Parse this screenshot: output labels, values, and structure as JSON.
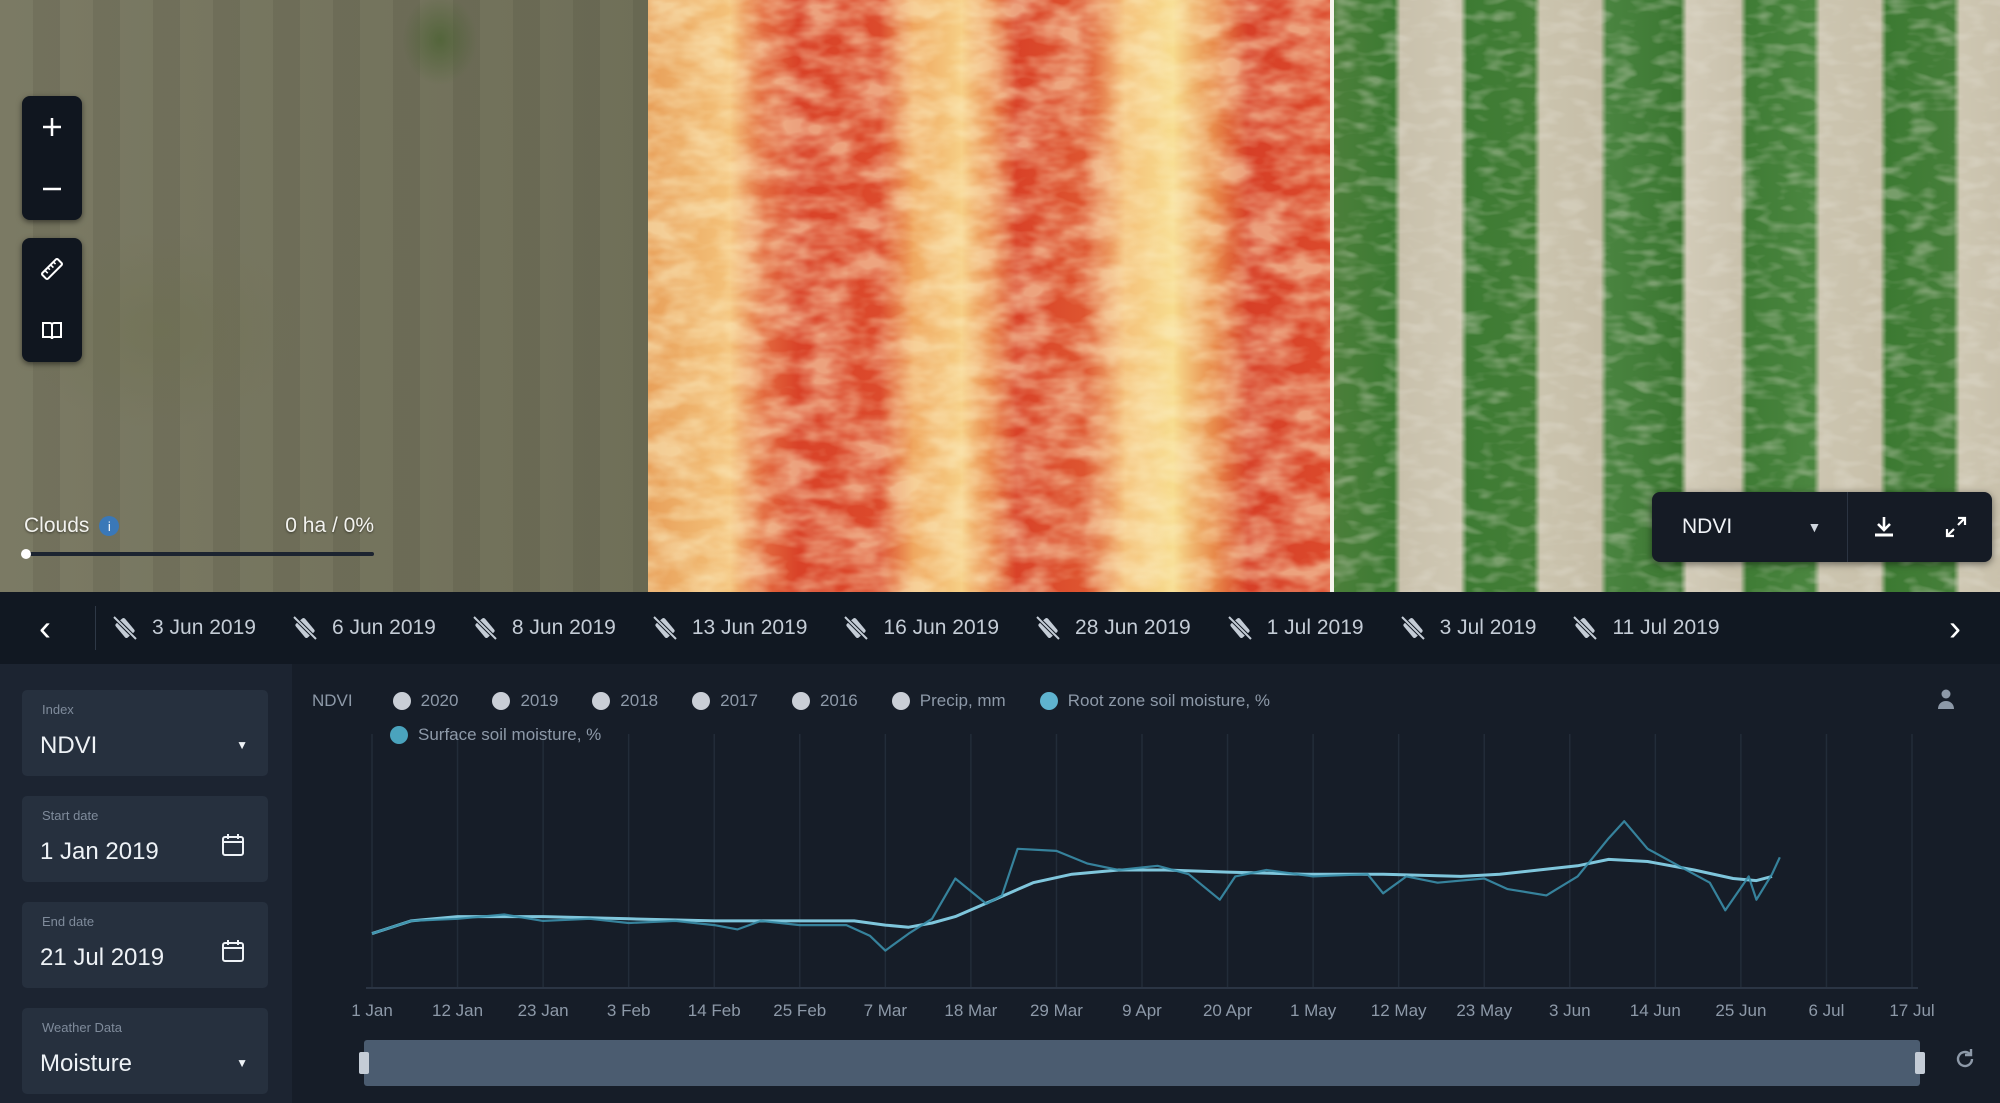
{
  "map": {
    "zoom_in_icon": "plus-icon",
    "zoom_out_icon": "minus-icon",
    "ruler_icon": "ruler-icon",
    "book_icon": "book-icon",
    "clouds": {
      "label": "Clouds",
      "value": "0 ha / 0%",
      "level": 0
    },
    "layer": {
      "name": "NDVI",
      "caret": "▼"
    },
    "colors": {
      "ndvi_red": "#dc4a2c",
      "ndvi_yellow": "#f7dc8e",
      "crop_green": "#3c7a32",
      "soil_beige": "#c9c1ac"
    }
  },
  "date_strip": {
    "prev": "‹",
    "next": "›",
    "dates": [
      "3 Jun 2019",
      "6 Jun 2019",
      "8 Jun 2019",
      "13 Jun 2019",
      "16 Jun 2019",
      "28 Jun 2019",
      "1 Jul 2019",
      "3 Jul 2019",
      "11 Jul 2019"
    ]
  },
  "sidebar": {
    "index": {
      "label": "Index",
      "value": "NDVI",
      "caret": "▼"
    },
    "start_date": {
      "label": "Start date",
      "value": "1 Jan 2019"
    },
    "end_date": {
      "label": "End date",
      "value": "21 Jul 2019"
    },
    "weather": {
      "label": "Weather Data",
      "value": "Moisture",
      "caret": "▼"
    }
  },
  "legend": {
    "index_tag": "NDVI",
    "items": [
      {
        "label": "2020",
        "color": "#c9ced6"
      },
      {
        "label": "2019",
        "color": "#c9ced6"
      },
      {
        "label": "2018",
        "color": "#c9ced6"
      },
      {
        "label": "2017",
        "color": "#c9ced6"
      },
      {
        "label": "2016",
        "color": "#c9ced6"
      },
      {
        "label": "Precip, mm",
        "color": "#c9ced6"
      },
      {
        "label": "Root zone soil moisture, %",
        "color": "#5fb3cf"
      },
      {
        "label": "Surface soil moisture, %",
        "color": "#4aa3bd"
      }
    ]
  },
  "chart_data": {
    "type": "line",
    "title": "",
    "xlabel": "",
    "ylabel": "",
    "grid": true,
    "x_ticks": [
      "1 Jan",
      "12 Jan",
      "23 Jan",
      "3 Feb",
      "14 Feb",
      "25 Feb",
      "7 Mar",
      "18 Mar",
      "29 Mar",
      "9 Apr",
      "20 Apr",
      "1 May",
      "12 May",
      "23 May",
      "3 Jun",
      "14 Jun",
      "25 Jun",
      "6 Jul",
      "17 Jul"
    ],
    "x_range_days": [
      0,
      198
    ],
    "y_range": [
      0,
      100
    ],
    "series": [
      {
        "name": "Root zone soil moisture, %",
        "color": "#7fc6dc",
        "points": [
          [
            0,
            20
          ],
          [
            5,
            26
          ],
          [
            11,
            28
          ],
          [
            22,
            28
          ],
          [
            33,
            27
          ],
          [
            44,
            26
          ],
          [
            55,
            26
          ],
          [
            62,
            26
          ],
          [
            66,
            24
          ],
          [
            69,
            23
          ],
          [
            72,
            25
          ],
          [
            75,
            28
          ],
          [
            80,
            36
          ],
          [
            85,
            44
          ],
          [
            90,
            48
          ],
          [
            96,
            50
          ],
          [
            102,
            50
          ],
          [
            110,
            49
          ],
          [
            120,
            48
          ],
          [
            130,
            48
          ],
          [
            140,
            47
          ],
          [
            145,
            48
          ],
          [
            150,
            50
          ],
          [
            155,
            52
          ],
          [
            159,
            55
          ],
          [
            164,
            54
          ],
          [
            170,
            50
          ],
          [
            175,
            46
          ],
          [
            178,
            45
          ],
          [
            180,
            47
          ]
        ]
      },
      {
        "name": "Surface soil moisture, %",
        "color": "#3a8ea9",
        "points": [
          [
            0,
            20
          ],
          [
            5,
            26
          ],
          [
            11,
            27
          ],
          [
            17,
            29
          ],
          [
            22,
            26
          ],
          [
            28,
            27
          ],
          [
            33,
            25
          ],
          [
            39,
            26
          ],
          [
            44,
            24
          ],
          [
            47,
            22
          ],
          [
            50,
            26
          ],
          [
            55,
            24
          ],
          [
            61,
            24
          ],
          [
            64,
            19
          ],
          [
            66,
            12
          ],
          [
            69,
            20
          ],
          [
            72,
            27
          ],
          [
            75,
            46
          ],
          [
            79,
            34
          ],
          [
            81,
            38
          ],
          [
            83,
            60
          ],
          [
            88,
            59
          ],
          [
            92,
            53
          ],
          [
            96,
            50
          ],
          [
            101,
            52
          ],
          [
            105,
            48
          ],
          [
            109,
            36
          ],
          [
            111,
            47
          ],
          [
            115,
            50
          ],
          [
            121,
            47
          ],
          [
            128,
            48
          ],
          [
            130,
            39
          ],
          [
            133,
            47
          ],
          [
            137,
            44
          ],
          [
            143,
            46
          ],
          [
            146,
            41
          ],
          [
            151,
            38
          ],
          [
            155,
            47
          ],
          [
            159,
            65
          ],
          [
            161,
            73
          ],
          [
            164,
            60
          ],
          [
            168,
            52
          ],
          [
            172,
            44
          ],
          [
            174,
            31
          ],
          [
            177,
            47
          ],
          [
            178,
            36
          ],
          [
            180,
            48
          ],
          [
            181,
            56
          ]
        ]
      }
    ],
    "range_slider": {
      "start_label": "1 Jan 2019",
      "end_label": "21 Jul 2019"
    }
  }
}
